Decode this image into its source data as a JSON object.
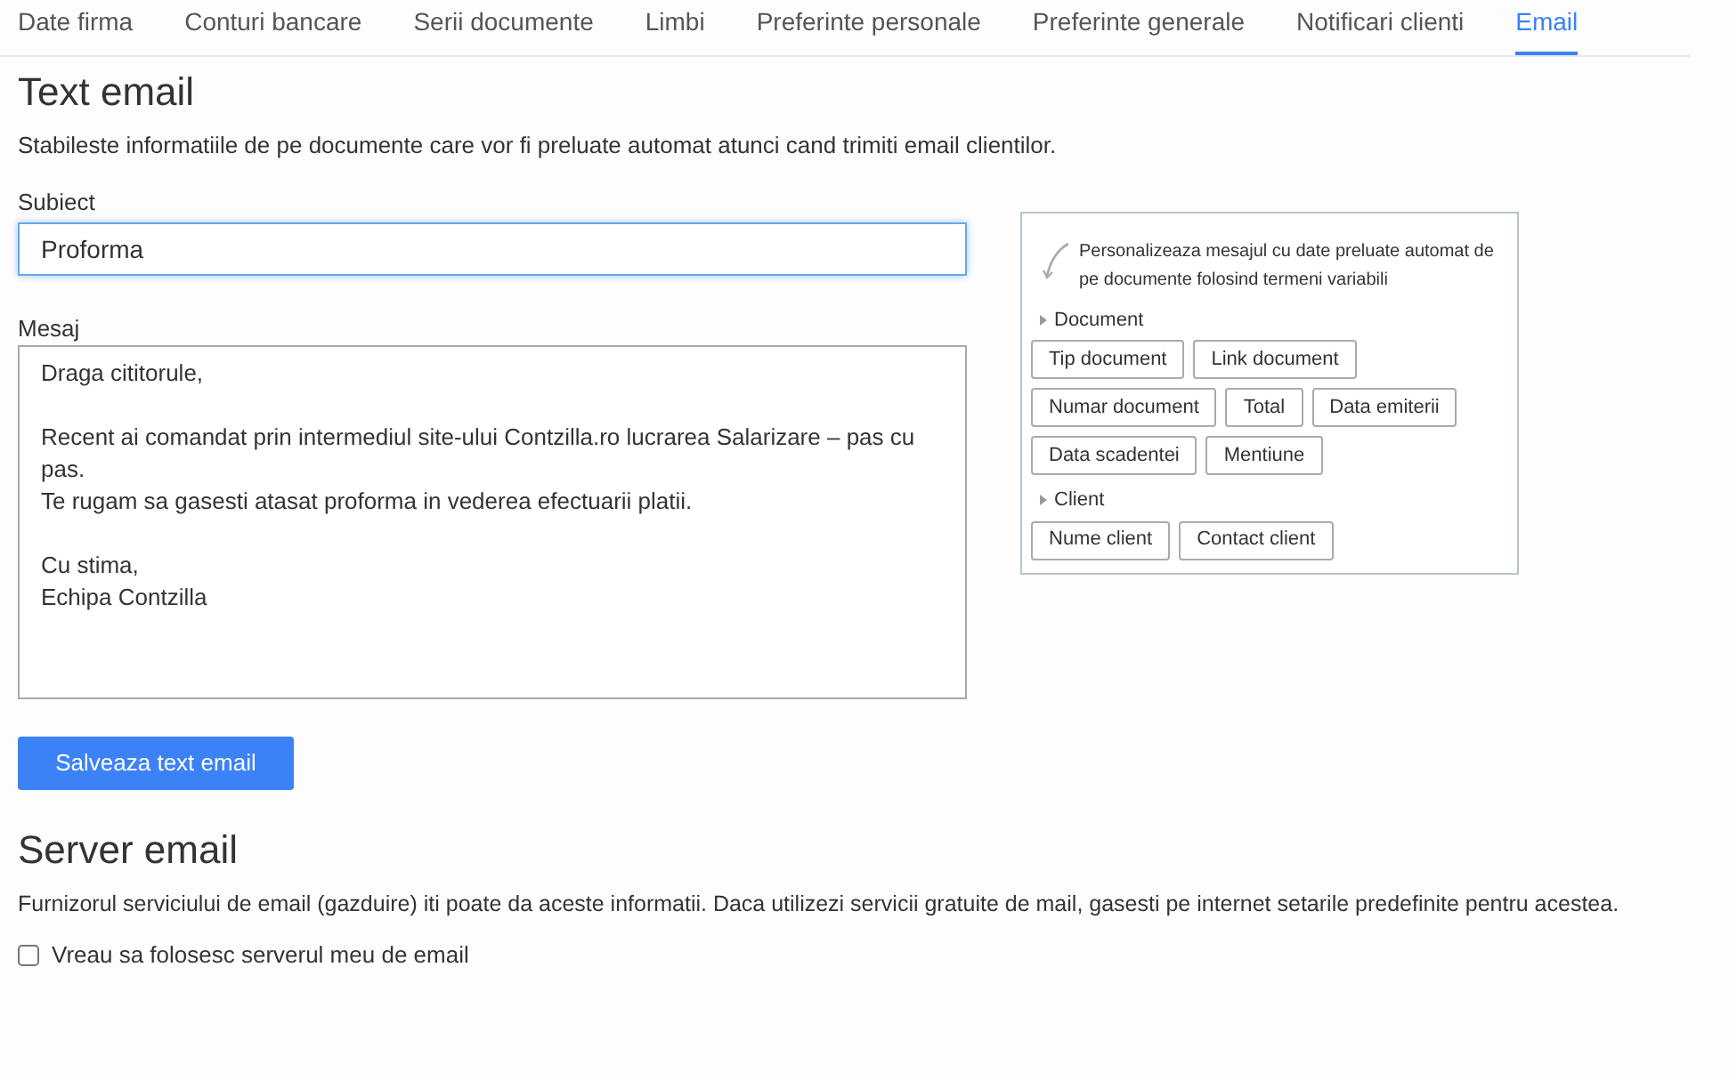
{
  "tabs": [
    {
      "label": "Date firma",
      "selected": false
    },
    {
      "label": "Conturi bancare",
      "selected": false
    },
    {
      "label": "Serii documente",
      "selected": false
    },
    {
      "label": "Limbi",
      "selected": false
    },
    {
      "label": "Preferinte personale",
      "selected": false
    },
    {
      "label": "Preferinte generale",
      "selected": false
    },
    {
      "label": "Notificari clienti",
      "selected": false
    },
    {
      "label": "Email",
      "selected": true
    }
  ],
  "text_email": {
    "title": "Text email",
    "description": "Stabileste informatiile de pe documente care vor fi preluate automat atunci cand trimiti email clientilor.",
    "subject": {
      "label": "Subiect",
      "value": "Proforma"
    },
    "message": {
      "label": "Mesaj",
      "value": "Draga cititorule,\n\nRecent ai comandat prin intermediul site-ului Contzilla.ro lucrarea Salarizare – pas cu pas.\nTe rugam sa gasesti atasat proforma in vederea efectuarii platii.\n\nCu stima,\nEchipa Contzilla"
    },
    "save_button": "Salveaza text email"
  },
  "variables_panel": {
    "hint": "Personalizeaza mesajul cu date preluate automat de pe documente folosind termeni variabili",
    "groups": [
      {
        "label": "Document",
        "terms": [
          "Tip document",
          "Link document",
          "Numar document",
          "Total",
          "Data emiterii",
          "Data scadentei",
          "Mentiune"
        ]
      },
      {
        "label": "Client",
        "terms": [
          "Nume client",
          "Contact client"
        ]
      }
    ]
  },
  "server_email": {
    "title": "Server email",
    "description": "Furnizorul serviciului de email (gazduire) iti poate da aceste informatii. Daca utilizezi servicii gratuite de mail, gasesti pe internet setarile predefinite pentru acestea.",
    "checkbox": {
      "label": "Vreau sa folosesc serverul meu de email",
      "checked": false
    }
  }
}
